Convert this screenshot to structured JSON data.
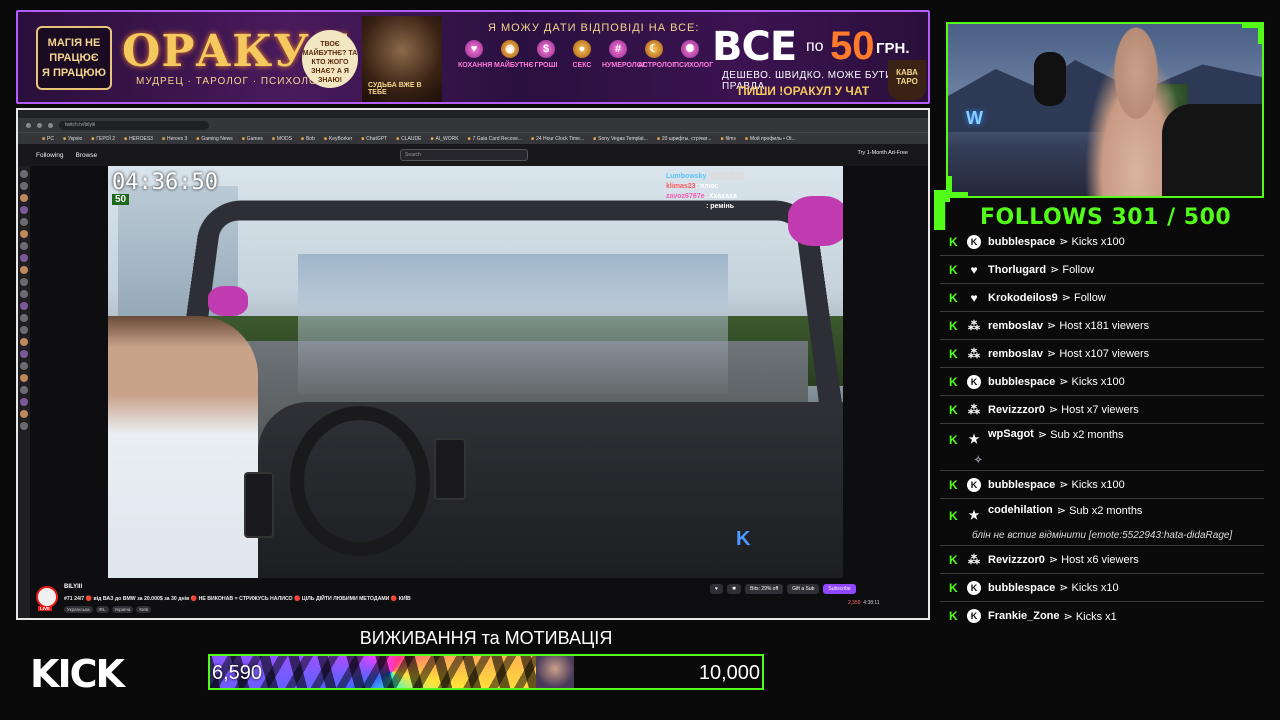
{
  "banner": {
    "magic_line1": "МАГІЯ НЕ",
    "magic_line2": "ПРАЦЮЄ",
    "magic_line3": "Я ПРАЦЮЮ",
    "title": "ОРАКУЛ",
    "subtitle": "МУДРЕЦ · ТАРОЛОГ · ПСИХОЛОГ",
    "speech": "ТВОЄ МАЙБУТНЄ? ТА КТО ЖОГО ЗНАЄ? А Я ЗНАЮ!",
    "wizard_caption": "СУДЬБА ВЖЕ В ТЕБЕ",
    "answers": "Я МОЖУ ДАТИ ВІДПОВІДІ НА ВСЕ:",
    "categories": [
      "КОХАННЯ",
      "МАЙБУТНЄ",
      "ГРОШІ",
      "СЕКС",
      "НУМЕРОЛОГ",
      "АСТРОЛОГ",
      "ПСИХОЛОГ"
    ],
    "all": "ВСЕ",
    "po": "по",
    "price": "50",
    "currency": "ГРН.",
    "tagline": "ДЕШЕВО. ШВИДКО. МОЖЕ БУТИ ПРАВДА.",
    "cta": "ПИШИ !ОРАКУЛ У ЧАТ",
    "cup": "КАВА ТАРО"
  },
  "browser": {
    "url": "twitch.tv/bilyiii",
    "bookmarks": [
      "PC",
      "Укрхіо",
      "ГЕРОЇ 2",
      "HEROES3",
      "Heroes 3",
      "Gaming News",
      "Games",
      "MODS",
      "Bob",
      "KeyBorker",
      "ChatGPT",
      "CLAUDE",
      "AI_WORK",
      "7 Gala Card Recove...",
      "24 Hour Clock Time...",
      "Sony Vegas Templat...",
      "20 шрифты, стрічки...",
      "films",
      "Мой профиль • Ot..."
    ],
    "nav_following": "Following",
    "nav_browse": "Browse",
    "search_placeholder": "Search",
    "ad_free": "Try 1-Month Ad-Free"
  },
  "video": {
    "clock": "04:36:50",
    "speed": "50",
    "chat": [
      {
        "name": "Lumbowsky",
        "text": ""
      },
      {
        "name": "klimas23",
        "text": ": плюс"
      },
      {
        "name": "zavoz6767e",
        "text": ": Ххахаха"
      },
      {
        "name": "",
        "text": ": ремінь"
      }
    ]
  },
  "stream_info": {
    "channel": "BILYIII",
    "title": "#71 24/7 🔴 від ВАЗ до BMW за 20.000$ за 30 днів 🔴 НЕ ВИКОНАВ = СТРИЖУСЬ НАЛИСО 🔴 ЦІЛЬ ДІЙТИ ЛЮБИМИ МЕТОДАМИ 🔴 КИЇВ",
    "tags": [
      "Українська",
      "IRL",
      "Україна",
      "Київ"
    ],
    "live": "LIVE",
    "bits": "Bits: 29% off",
    "gift": "Gift a Sub",
    "subscribe": "Subscribe",
    "viewers": "2,359",
    "uptime": "4:38:11"
  },
  "follows": {
    "label": "FOLLOWS",
    "current": "301",
    "target": "500"
  },
  "events": [
    {
      "icon": "kick",
      "name": "bubblespace",
      "action": "Kicks x100"
    },
    {
      "icon": "heart",
      "name": "Thorlugard",
      "action": "Follow"
    },
    {
      "icon": "heart",
      "name": "Krokodeilos9",
      "action": "Follow"
    },
    {
      "icon": "host",
      "name": "remboslav",
      "action": "Host x181 viewers"
    },
    {
      "icon": "host",
      "name": "remboslav",
      "action": "Host x107 viewers"
    },
    {
      "icon": "kick",
      "name": "bubblespace",
      "action": "Kicks x100"
    },
    {
      "icon": "host",
      "name": "Revizzzor0",
      "action": "Host x7 viewers"
    },
    {
      "icon": "star",
      "name": "wpSagot",
      "action": "Sub x2 months",
      "extra": "emote"
    },
    {
      "icon": "kick",
      "name": "bubblespace",
      "action": "Kicks x100"
    },
    {
      "icon": "star",
      "name": "codehilation",
      "action": "Sub x2 months",
      "message": "блін не встиг відмінити [emote:5522943:hata-didaRage]"
    },
    {
      "icon": "host",
      "name": "Revizzzor0",
      "action": "Host x6 viewers"
    },
    {
      "icon": "kick",
      "name": "bubblespace",
      "action": "Kicks x10"
    },
    {
      "icon": "kick",
      "name": "Frankie_Zone",
      "action": "Kicks x1"
    }
  ],
  "goal": {
    "title": "ВИЖИВАННЯ та МОТИВАЦІЯ",
    "current": "6,590",
    "target": "10,000",
    "fraction": 0.659
  },
  "logo": "KICK",
  "colors": {
    "accent": "#53fc18",
    "twitch": "#9147ff",
    "banner_border": "#b45cff"
  }
}
